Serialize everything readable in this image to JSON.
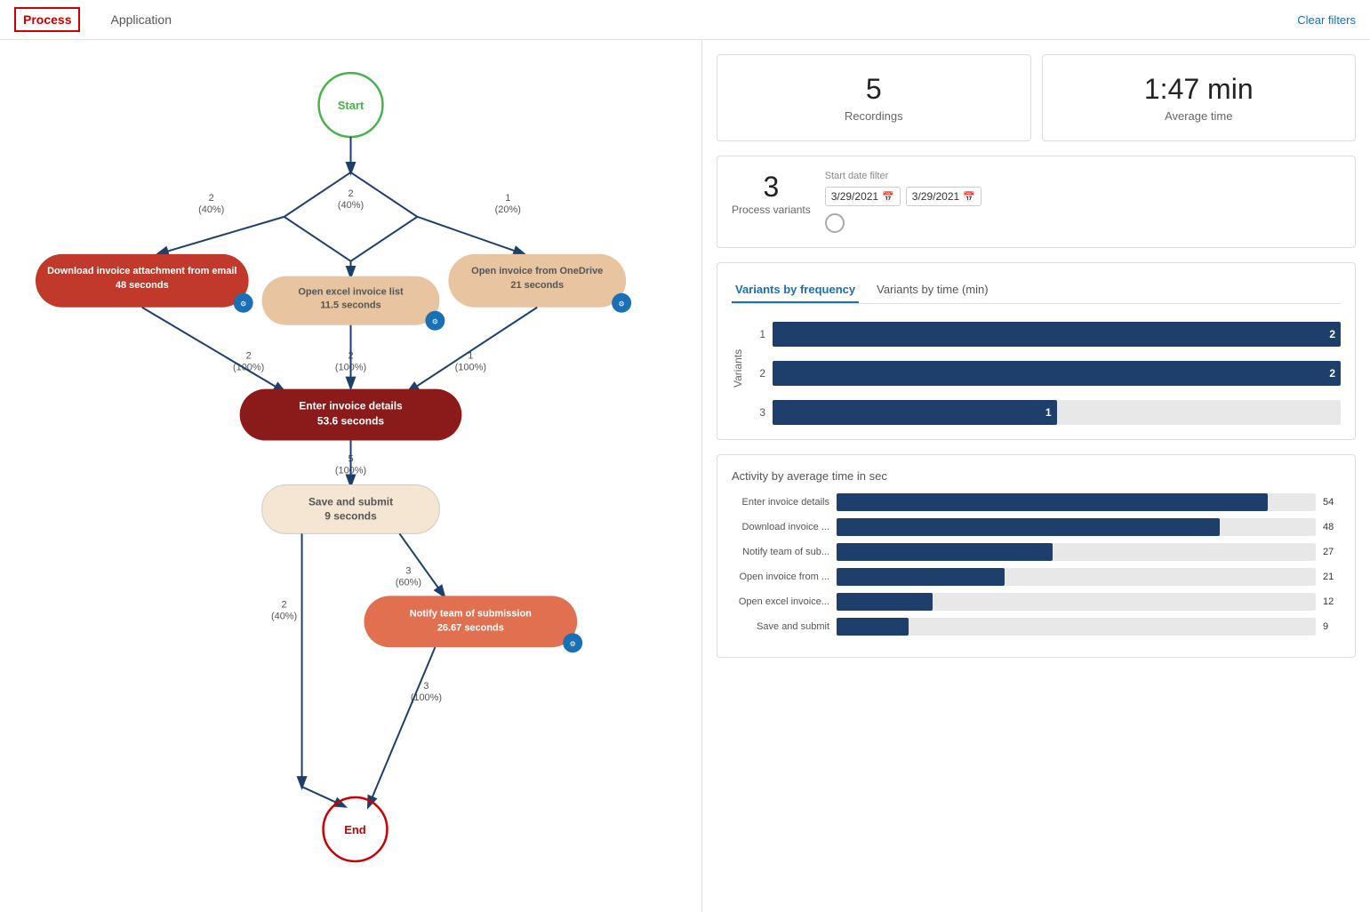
{
  "nav": {
    "tabs": [
      {
        "id": "process",
        "label": "Process",
        "active": true
      },
      {
        "id": "application",
        "label": "Application",
        "active": false
      }
    ],
    "clear_filters": "Clear filters"
  },
  "stats": {
    "recordings": {
      "value": "5",
      "label": "Recordings"
    },
    "average_time": {
      "value": "1:47 min",
      "label": "Average time"
    },
    "process_variants": {
      "value": "3",
      "label": "Process variants"
    }
  },
  "date_filter": {
    "label": "Start date filter",
    "start": "3/29/2021",
    "end": "3/29/2021"
  },
  "chart_tabs": [
    {
      "id": "frequency",
      "label": "Variants by frequency",
      "active": true
    },
    {
      "id": "time",
      "label": "Variants by time (min)",
      "active": false
    }
  ],
  "variants_chart": {
    "y_axis_label": "Variants",
    "bars": [
      {
        "variant": "1",
        "value": 2,
        "max": 2
      },
      {
        "variant": "2",
        "value": 2,
        "max": 2
      },
      {
        "variant": "3",
        "value": 1,
        "max": 2
      }
    ]
  },
  "activity_chart": {
    "title": "Activity by average time in sec",
    "bars": [
      {
        "label": "Enter invoice details",
        "value": 54,
        "display": "54",
        "max": 60
      },
      {
        "label": "Download invoice ...",
        "value": 48,
        "display": "48",
        "max": 60
      },
      {
        "label": "Notify team of sub...",
        "value": 27,
        "display": "27",
        "max": 60
      },
      {
        "label": "Open invoice from ...",
        "value": 21,
        "display": "21",
        "max": 60
      },
      {
        "label": "Open excel invoice...",
        "value": 12,
        "display": "12",
        "max": 60
      },
      {
        "label": "Save and submit",
        "value": 9,
        "display": "9",
        "max": 60
      }
    ]
  },
  "diagram": {
    "nodes": {
      "start": "Start",
      "end": "End",
      "download_invoice": "Download invoice attachment from email\n48 seconds",
      "open_excel": "Open excel invoice list\n11.5 seconds",
      "open_onedrive": "Open invoice from OneDrive\n21 seconds",
      "enter_invoice": "Enter invoice details\n53.6 seconds",
      "save_submit": "Save and submit\n9 seconds",
      "notify_team": "Notify team of submission\n26.67 seconds"
    },
    "edges": {
      "start_to_download": {
        "count": "2",
        "pct": "(40%)"
      },
      "start_to_excel": {
        "count": "2",
        "pct": "(40%)"
      },
      "start_to_onedrive": {
        "count": "1",
        "pct": "(20%)"
      },
      "download_to_enter": {
        "count": "2",
        "pct": "(100%)"
      },
      "excel_to_enter": {
        "count": "2",
        "pct": "(100%)"
      },
      "onedrive_to_enter": {
        "count": "1",
        "pct": "(100%)"
      },
      "enter_to_save": {
        "count": "5",
        "pct": "(100%)"
      },
      "save_to_notify": {
        "count": "3",
        "pct": "(60%)"
      },
      "save_to_end": {
        "count": "2",
        "pct": "(40%)"
      },
      "notify_to_end": {
        "count": "3",
        "pct": "(100%)"
      }
    }
  }
}
